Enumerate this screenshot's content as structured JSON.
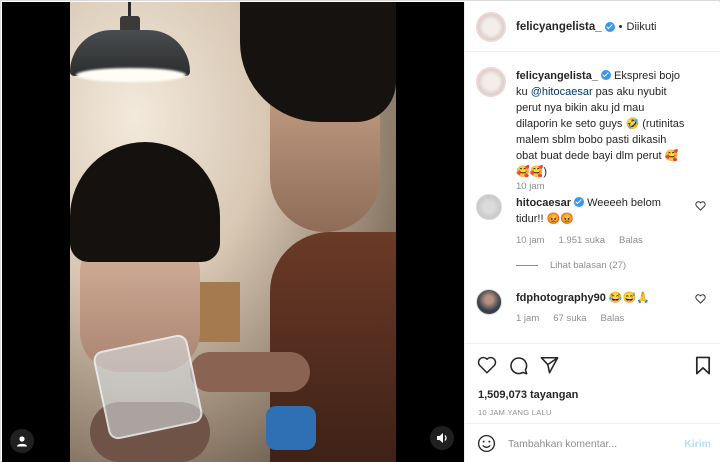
{
  "header": {
    "username": "felicyangelista_",
    "separator": "•",
    "follow_status": "Diikuti"
  },
  "caption": {
    "username": "felicyangelista_",
    "text_before": " Ekspresi bojo ku ",
    "mention": "@hitocaesar",
    "text_after": " pas aku nyubit perut nya bikin aku jd mau dilaporin ke seto guys 🤣 (rutinitas malem sblm bobo pasti dikasih obat buat dede bayi dlm perut 🥰🥰🥰)",
    "time": "10 jam"
  },
  "comments": [
    {
      "username": "hitocaesar",
      "text": " Weeeeh belom tidur!! 😡😡",
      "time": "10 jam",
      "likes": "1.951 suka",
      "reply": "Balas",
      "view_replies": "Lihat balasan (27)"
    },
    {
      "username": "fdphotography90",
      "text": " 😂😅🙏",
      "time": "1 jam",
      "likes": "67 suka",
      "reply": "Balas"
    }
  ],
  "actions": {
    "views": "1,509,073 tayangan",
    "ago": "10 JAM YANG LALU"
  },
  "comment_box": {
    "placeholder": "Tambahkan komentar...",
    "post_label": "Kirim"
  },
  "colors": {
    "link": "#00376b",
    "verified": "#3897f0",
    "muted": "#8e8e8e",
    "post_disabled": "#b2dffc"
  },
  "icons": [
    "user-icon",
    "speaker-icon",
    "verified-badge-icon",
    "heart-icon",
    "comment-icon",
    "share-icon",
    "bookmark-icon",
    "emoji-icon"
  ]
}
